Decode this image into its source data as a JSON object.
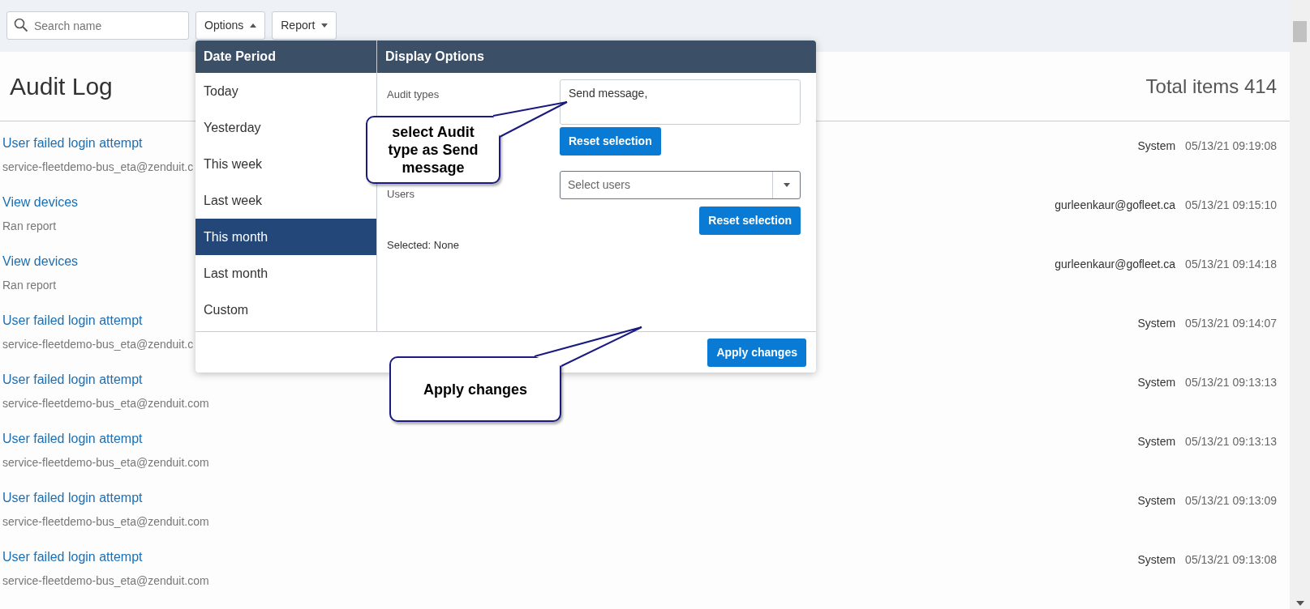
{
  "toolbar": {
    "search": {
      "placeholder": "Search name"
    },
    "buttons": [
      {
        "label": "Options",
        "expanded": true
      },
      {
        "label": "Report",
        "expanded": false
      }
    ]
  },
  "page": {
    "title": "Audit Log",
    "total": "Total items 414"
  },
  "rows": [
    {
      "title": "User failed login attempt",
      "subtitle": "service-fleetdemo-bus_eta@zenduit.c",
      "user": "System",
      "time": "05/13/21 09:19:08"
    },
    {
      "title": "View devices",
      "subtitle": "Ran report",
      "user": "gurleenkaur@gofleet.ca",
      "time": "05/13/21 09:15:10"
    },
    {
      "title": "View devices",
      "subtitle": "Ran report",
      "user": "gurleenkaur@gofleet.ca",
      "time": "05/13/21 09:14:18"
    },
    {
      "title": "User failed login attempt",
      "subtitle": "service-fleetdemo-bus_eta@zenduit.c",
      "user": "System",
      "time": "05/13/21 09:14:07"
    },
    {
      "title": "User failed login attempt",
      "subtitle": "service-fleetdemo-bus_eta@zenduit.com",
      "user": "System",
      "time": "05/13/21 09:13:13"
    },
    {
      "title": "User failed login attempt",
      "subtitle": "service-fleetdemo-bus_eta@zenduit.com",
      "user": "System",
      "time": "05/13/21 09:13:13"
    },
    {
      "title": "User failed login attempt",
      "subtitle": "service-fleetdemo-bus_eta@zenduit.com",
      "user": "System",
      "time": "05/13/21 09:13:09"
    },
    {
      "title": "User failed login attempt",
      "subtitle": "service-fleetdemo-bus_eta@zenduit.com",
      "user": "System",
      "time": "05/13/21 09:13:08"
    }
  ],
  "options_panel": {
    "date_period": {
      "header": "Date Period",
      "items": [
        {
          "label": "Today",
          "selected": false
        },
        {
          "label": "Yesterday",
          "selected": false
        },
        {
          "label": "This week",
          "selected": false
        },
        {
          "label": "Last week",
          "selected": false
        },
        {
          "label": "This month",
          "selected": true
        },
        {
          "label": "Last month",
          "selected": false
        },
        {
          "label": "Custom",
          "selected": false
        }
      ]
    },
    "display_options": {
      "header": "Display Options",
      "audit_types": {
        "label": "Audit types",
        "value": "Send message,",
        "button": "Reset selection"
      },
      "users": {
        "label": "Users",
        "placeholder": "Select users",
        "button": "Reset selection"
      },
      "selected_text": "Selected: None"
    },
    "apply_button": "Apply changes"
  },
  "callouts": [
    {
      "text": "select Audit type as Send message"
    },
    {
      "text": "Apply changes"
    }
  ]
}
